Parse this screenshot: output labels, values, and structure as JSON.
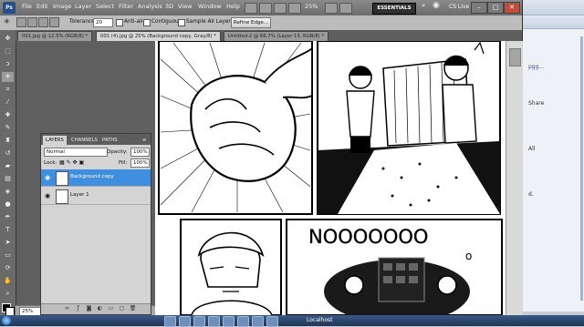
{
  "menubar": {
    "app_logo": "Ps",
    "items": [
      "File",
      "Edit",
      "Image",
      "Layer",
      "Select",
      "Filter",
      "Analysis",
      "3D",
      "View",
      "Window",
      "Help"
    ],
    "zoom_value": "25%",
    "workspace": "ESSENTIALS",
    "cs_live": "CS Live",
    "window_controls": [
      "–",
      "□",
      "✕"
    ]
  },
  "options": {
    "tolerance_label": "Tolerance:",
    "tolerance_value": "20",
    "antialias_label": "Anti-alias",
    "contiguous_label": "Contiguous",
    "sample_all_label": "Sample All Layers",
    "refine_edge_label": "Refine Edge..."
  },
  "tabs": [
    {
      "label": "001.jpg @ 12.5% (RGB/8) *",
      "active": false
    },
    {
      "label": "001 (4).jpg @ 25% (Background copy, Gray/8) *",
      "active": true
    },
    {
      "label": "Untitled-2 @ 66.7% (Layer 13, RGB/8) *",
      "active": false
    }
  ],
  "status": {
    "zoom": "25%"
  },
  "layers_panel": {
    "tabs": [
      "LAYERS",
      "CHANNELS",
      "PATHS"
    ],
    "blend_mode": "Normal",
    "opacity_label": "Opacity:",
    "opacity_value": "100%",
    "lock_label": "Lock:",
    "fill_label": "Fill:",
    "fill_value": "100%",
    "layers": [
      {
        "name": "Background copy",
        "selected": true
      },
      {
        "name": "Layer 1",
        "selected": false
      }
    ],
    "footer_icons": [
      "link-icon",
      "fx-icon",
      "mask-icon",
      "adjustment-icon",
      "folder-icon",
      "new-layer-icon",
      "trash-icon"
    ]
  },
  "comic": {
    "sound_text": "NOOOOOOO",
    "sound_tail": "o"
  },
  "background_window": {
    "items": [
      "pgg...",
      "Share",
      "All",
      "d."
    ]
  },
  "taskbar": {
    "locale_text": "Localhost"
  },
  "colors": {
    "selection": "#3f8fe0",
    "ps_chrome": "#5f5f5f"
  }
}
